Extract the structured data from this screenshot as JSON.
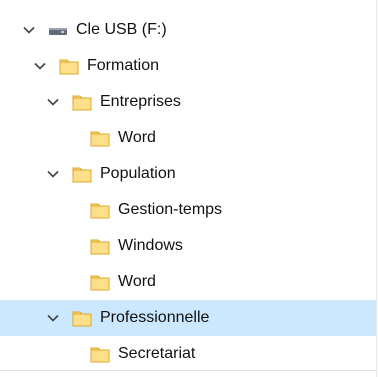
{
  "tree": {
    "drive": {
      "label": "Cle USB (F:)",
      "icon": "usb-drive-icon",
      "expanded": true
    },
    "formation": {
      "label": "Formation",
      "icon": "folder-icon",
      "expanded": true
    },
    "entreprises": {
      "label": "Entreprises",
      "icon": "folder-icon",
      "expanded": true
    },
    "entreprises_word": {
      "label": "Word",
      "icon": "folder-icon"
    },
    "population": {
      "label": "Population",
      "icon": "folder-icon",
      "expanded": true
    },
    "gestion_temps": {
      "label": "Gestion-temps",
      "icon": "folder-icon"
    },
    "windows": {
      "label": "Windows",
      "icon": "folder-icon"
    },
    "population_word": {
      "label": "Word",
      "icon": "folder-icon"
    },
    "professionnelle": {
      "label": "Professionnelle",
      "icon": "folder-icon",
      "expanded": true,
      "selected": true
    },
    "secretariat": {
      "label": "Secretariat",
      "icon": "folder-icon"
    }
  },
  "colors": {
    "selection": "#cce8ff",
    "folder_fill": "#ffd86b",
    "folder_edge": "#d9a928",
    "chevron": "#444444"
  }
}
